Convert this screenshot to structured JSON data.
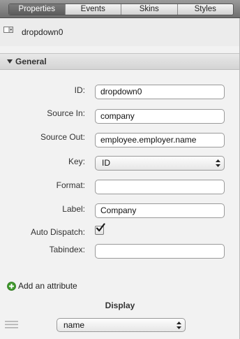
{
  "tabs": [
    {
      "label": "Properties",
      "active": true
    },
    {
      "label": "Events",
      "active": false
    },
    {
      "label": "Skins",
      "active": false
    },
    {
      "label": "Styles",
      "active": false
    }
  ],
  "component": {
    "name": "dropdown0",
    "icon": "dropdown-component-icon"
  },
  "section": {
    "title": "General",
    "expanded": true
  },
  "fields": {
    "id": {
      "label": "ID:",
      "value": "dropdown0"
    },
    "source_in": {
      "label": "Source In:",
      "value": "company"
    },
    "source_out": {
      "label": "Source Out:",
      "value": "employee.employer.name"
    },
    "key": {
      "label": "Key:",
      "selected": "ID"
    },
    "format": {
      "label": "Format:",
      "value": ""
    },
    "label": {
      "label": "Label:",
      "value": "Company"
    },
    "auto_dispatch": {
      "label": "Auto Dispatch:",
      "checked": true
    },
    "tabindex": {
      "label": "Tabindex:",
      "value": ""
    }
  },
  "add_attribute": {
    "label": "Add an attribute",
    "icon": "add-circle-icon"
  },
  "display": {
    "title": "Display",
    "selected": "name"
  },
  "colors": {
    "add_icon": "#3f9a2c",
    "active_tab": "#666666"
  }
}
